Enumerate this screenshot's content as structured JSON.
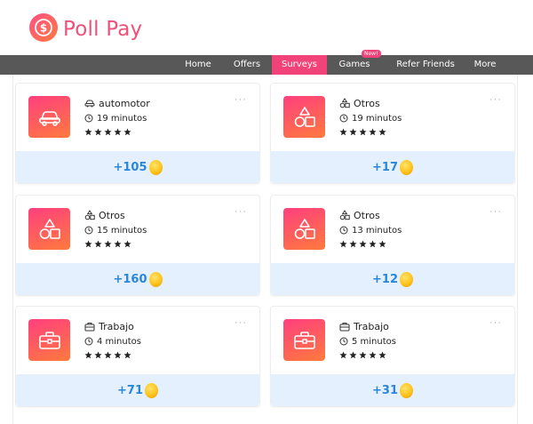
{
  "brand": {
    "name": "Poll Pay",
    "logo_icon": "dollar-circle-icon"
  },
  "nav": {
    "items": [
      {
        "label": "Home",
        "active": false
      },
      {
        "label": "Offers",
        "active": false
      },
      {
        "label": "Surveys",
        "active": true
      },
      {
        "label": "Games",
        "active": false,
        "badge": "New!"
      },
      {
        "label": "Refer Friends",
        "active": false
      },
      {
        "label": "More",
        "active": false
      }
    ]
  },
  "colors": {
    "brand_pink": "#f2427a",
    "brand_orange": "#ff7a3d",
    "nav_bg": "#585858",
    "points_blue": "#2a86d8",
    "footer_bg": "#e4f0fd"
  },
  "surveys": [
    {
      "category": "automotor",
      "category_icon": "car-icon",
      "time": "19 minutos",
      "stars": 5,
      "points": "+105",
      "more": "···"
    },
    {
      "category": "Otros",
      "category_icon": "shapes-icon",
      "time": "19 minutos",
      "stars": 5,
      "points": "+17",
      "more": "···"
    },
    {
      "category": "Otros",
      "category_icon": "shapes-icon",
      "time": "15 minutos",
      "stars": 5,
      "points": "+160",
      "more": "···"
    },
    {
      "category": "Otros",
      "category_icon": "shapes-icon",
      "time": "13 minutos",
      "stars": 5,
      "points": "+12",
      "more": "···"
    },
    {
      "category": "Trabajo",
      "category_icon": "briefcase-icon",
      "time": "4 minutos",
      "stars": 5,
      "points": "+71",
      "more": "···"
    },
    {
      "category": "Trabajo",
      "category_icon": "briefcase-icon",
      "time": "5 minutos",
      "stars": 5,
      "points": "+31",
      "more": "···"
    }
  ]
}
